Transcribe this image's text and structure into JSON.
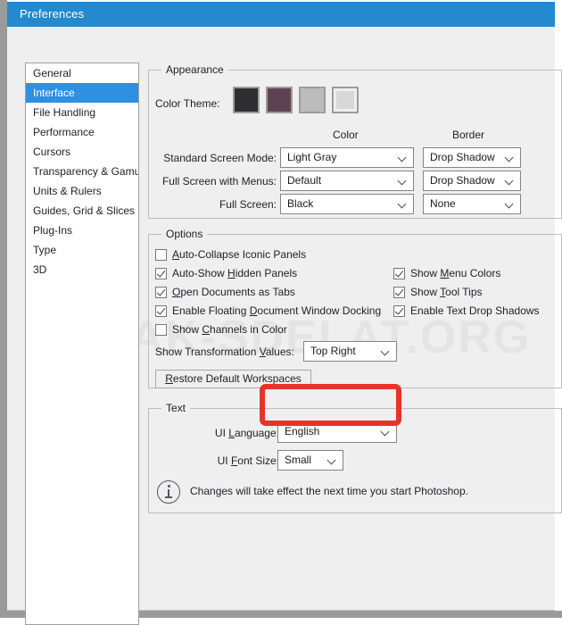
{
  "window": {
    "title": "Preferences",
    "watermark": "KAK-SDELAT.ORG",
    "accent_color": "#2489ce",
    "highlight_color": "#e8332a"
  },
  "sidebar": {
    "items": [
      {
        "label": "General",
        "selected": false
      },
      {
        "label": "Interface",
        "selected": true
      },
      {
        "label": "File Handling",
        "selected": false
      },
      {
        "label": "Performance",
        "selected": false
      },
      {
        "label": "Cursors",
        "selected": false
      },
      {
        "label": "Transparency & Gamut",
        "selected": false
      },
      {
        "label": "Units & Rulers",
        "selected": false
      },
      {
        "label": "Guides, Grid & Slices",
        "selected": false
      },
      {
        "label": "Plug-Ins",
        "selected": false
      },
      {
        "label": "Type",
        "selected": false
      },
      {
        "label": "3D",
        "selected": false
      }
    ]
  },
  "appearance": {
    "title": "Appearance",
    "color_theme_label": "Color Theme:",
    "swatches": [
      {
        "name": "dark",
        "color": "#2e2e31",
        "selected": false
      },
      {
        "name": "plum",
        "color": "#5f4252",
        "selected": false
      },
      {
        "name": "medium-gray",
        "color": "#bcbcbc",
        "selected": false
      },
      {
        "name": "light-gray",
        "color": "#d8d8d8",
        "selected": true
      }
    ],
    "column_headers": {
      "color": "Color",
      "border": "Border"
    },
    "rows": [
      {
        "label": "Standard Screen Mode:",
        "color": "Light Gray",
        "border": "Drop Shadow"
      },
      {
        "label": "Full Screen with Menus:",
        "color": "Default",
        "border": "Drop Shadow"
      },
      {
        "label": "Full Screen:",
        "color": "Black",
        "border": "None"
      }
    ]
  },
  "options": {
    "title": "Options",
    "left_checks": [
      {
        "label": "Auto-Collapse Iconic Panels",
        "accel": "A",
        "checked": false
      },
      {
        "label": "Auto-Show Hidden Panels",
        "accel": "H",
        "checked": true
      },
      {
        "label": "Open Documents as Tabs",
        "accel": "O",
        "checked": true
      },
      {
        "label": "Enable Floating Document Window Docking",
        "accel": "D",
        "checked": true
      },
      {
        "label": "Show Channels in Color",
        "accel": "C",
        "checked": false
      }
    ],
    "right_checks": [
      {
        "label": "Show Menu Colors",
        "accel": "M",
        "checked": true
      },
      {
        "label": "Show Tool Tips",
        "accel": "T",
        "checked": true
      },
      {
        "label": "Enable Text Drop Shadows",
        "accel": "",
        "checked": true
      }
    ],
    "transformation_label": "Show Transformation Values:",
    "transformation_accel": "V",
    "transformation_value": "Top Right",
    "restore_button": "Restore Default Workspaces",
    "restore_accel": "R"
  },
  "text_section": {
    "title": "Text",
    "ui_language_label": "UI Language:",
    "ui_language_accel": "L",
    "ui_language_value": "English",
    "ui_font_size_label": "UI Font Size:",
    "ui_font_size_accel": "F",
    "ui_font_size_value": "Small",
    "note": "Changes will take effect the next time you start Photoshop.",
    "note_icon": "info-icon"
  }
}
